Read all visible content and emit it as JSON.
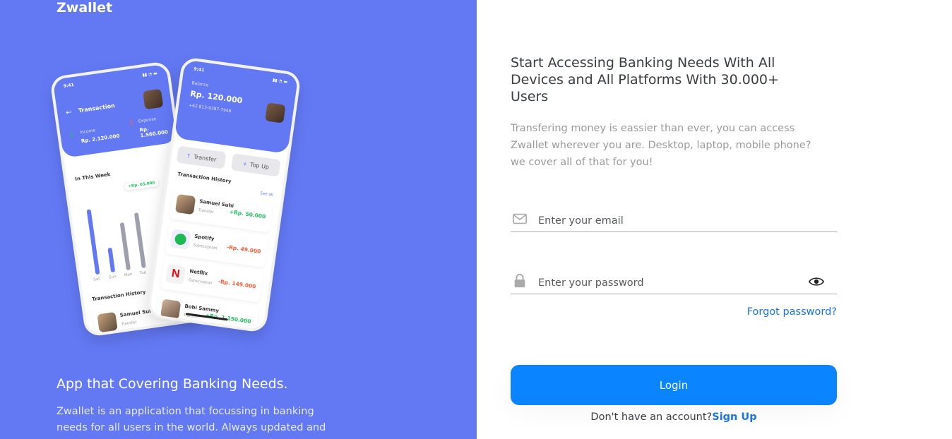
{
  "brand": {
    "name": "Zwallet"
  },
  "left": {
    "title": "App that Covering Banking Needs.",
    "description": "Zwallet is an application that focussing in banking needs for all users in the world. Always updated and"
  },
  "mockup": {
    "phone1": {
      "time": "9:41",
      "header": "Transaction",
      "income_label": "Income",
      "income_value": "Rp. 2.120.000",
      "expense_label": "Expense",
      "expense_value": "Rp. 1.560.000",
      "week_label": "In This Week",
      "tooltip": "+Rp. 65.000",
      "days": [
        "Sat",
        "Sun",
        "Mon",
        "Tue"
      ],
      "bars": [
        0.85,
        0.32,
        0.62,
        0.72
      ],
      "history_label": "Transaction History",
      "row": {
        "name": "Samuel Suhi",
        "sub": "Transfer"
      }
    },
    "phone2": {
      "time": "9:41",
      "balance_label": "Balance",
      "balance_value": "Rp. 120.000",
      "phone": "+62 813-9387-7946",
      "transfer": "Transfer",
      "topup": "Top Up",
      "history_label": "Transaction History",
      "see_all": "See all",
      "rows": [
        {
          "name": "Samuel Suhi",
          "sub": "Transfer",
          "amount": "+Rp. 50.000"
        },
        {
          "name": "Spotify",
          "sub": "Subscription",
          "amount": "-Rp. 49.000"
        },
        {
          "name": "Netflix",
          "sub": "Subscription",
          "amount": "-Rp. 149.000"
        },
        {
          "name": "Bobi Sammy",
          "sub": "Transfer",
          "amount": "+Rp. 1.150.000"
        }
      ]
    }
  },
  "right": {
    "title": "Start Accessing Banking Needs With All Devices and All Platforms With 30.000+ Users",
    "description": "Transfering money is eassier than ever, you can access Zwallet wherever you are. Desktop, laptop, mobile phone? we cover all of that for you!"
  },
  "form": {
    "email_placeholder": "Enter your email",
    "password_placeholder": "Enter your password",
    "forgot": "Forgot password?",
    "login": "Login",
    "no_account": "Don't have an account?",
    "signup": "Sign Up"
  },
  "colors": {
    "primary": "#6379F4",
    "button": "#0A84FF",
    "link": "#1A73E8",
    "text": "#3A3D42",
    "muted": "#9a9a9a",
    "success": "#1EC15F",
    "danger": "#FF5B37"
  },
  "icons": [
    "mail-icon",
    "lock-icon",
    "eye-icon"
  ]
}
